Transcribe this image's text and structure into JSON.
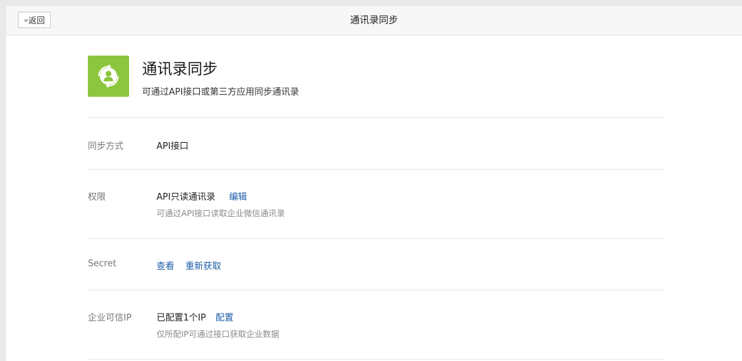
{
  "header": {
    "back_label": "返回",
    "title": "通讯录同步"
  },
  "app": {
    "icon": "contact-sync-icon",
    "icon_color": "#8cc63e",
    "name": "通讯录同步",
    "description": "可通过API接口或第三方应用同步通讯录"
  },
  "rows": {
    "sync_method": {
      "label": "同步方式",
      "value": "API接口"
    },
    "permission": {
      "label": "权限",
      "value": "API只读通讯录",
      "action": "编辑",
      "note": "可通过API接口读取企业微信通讯录"
    },
    "secret": {
      "label": "Secret",
      "view_action": "查看",
      "refresh_action": "重新获取"
    },
    "trusted_ip": {
      "label": "企业可信IP",
      "value": "已配置1个IP",
      "action": "配置",
      "note": "仅所配IP可通过接口获取企业数据"
    }
  },
  "colors": {
    "link": "#1d5ea8",
    "accent": "#8cc63e"
  }
}
